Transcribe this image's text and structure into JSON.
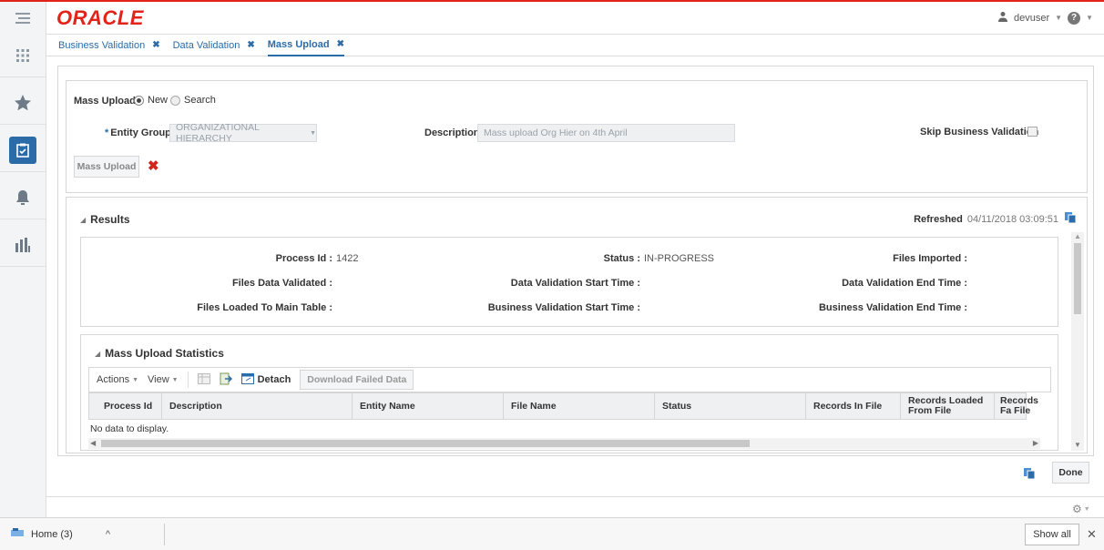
{
  "header": {
    "logo": "ORACLE",
    "user": "devuser",
    "menu_icon": "hamburger-icon",
    "help_icon": "help-icon"
  },
  "sidebar": {
    "items": [
      {
        "icon": "apps-grid-icon"
      },
      {
        "icon": "star-icon"
      },
      {
        "icon": "tasks-clipboard-icon",
        "active": true
      },
      {
        "icon": "bell-icon"
      },
      {
        "icon": "bar-chart-icon"
      }
    ]
  },
  "tabs": [
    {
      "label": "Business Validation"
    },
    {
      "label": "Data Validation"
    },
    {
      "label": "Mass Upload",
      "active": true
    }
  ],
  "form": {
    "mass_upload_label": "Mass Upload",
    "radio_new": "New",
    "radio_search": "Search",
    "entity_group_label": "Entity Group",
    "entity_group_value": "ORGANIZATIONAL HIERARCHY",
    "description_label": "Description",
    "description_value": "Mass upload Org Hier on 4th April",
    "skip_label": "Skip Business Validation",
    "mass_upload_button": "Mass Upload"
  },
  "results": {
    "title": "Results",
    "refreshed_label": "Refreshed",
    "refreshed_value": "04/11/2018 03:09:51",
    "process_id_label": "Process Id :",
    "process_id_value": "1422",
    "status_label": "Status :",
    "status_value": "IN-PROGRESS",
    "files_imported_label": "Files Imported :",
    "files_data_validated_label": "Files Data Validated :",
    "dv_start_label": "Data Validation Start Time :",
    "dv_end_label": "Data Validation End Time :",
    "files_loaded_label": "Files Loaded To Main Table :",
    "bv_start_label": "Business Validation Start Time :",
    "bv_end_label": "Business Validation End Time :"
  },
  "stats": {
    "title": "Mass Upload Statistics",
    "actions": "Actions",
    "view": "View",
    "detach": "Detach",
    "download_failed": "Download Failed Data",
    "columns": [
      "Process Id",
      "Description",
      "Entity Name",
      "File Name",
      "Status",
      "Records In File",
      "Records Loaded From File",
      "Records Fa File"
    ],
    "empty": "No data to display."
  },
  "footer": {
    "done": "Done",
    "download_item": "Home (3)",
    "show_all": "Show all"
  }
}
